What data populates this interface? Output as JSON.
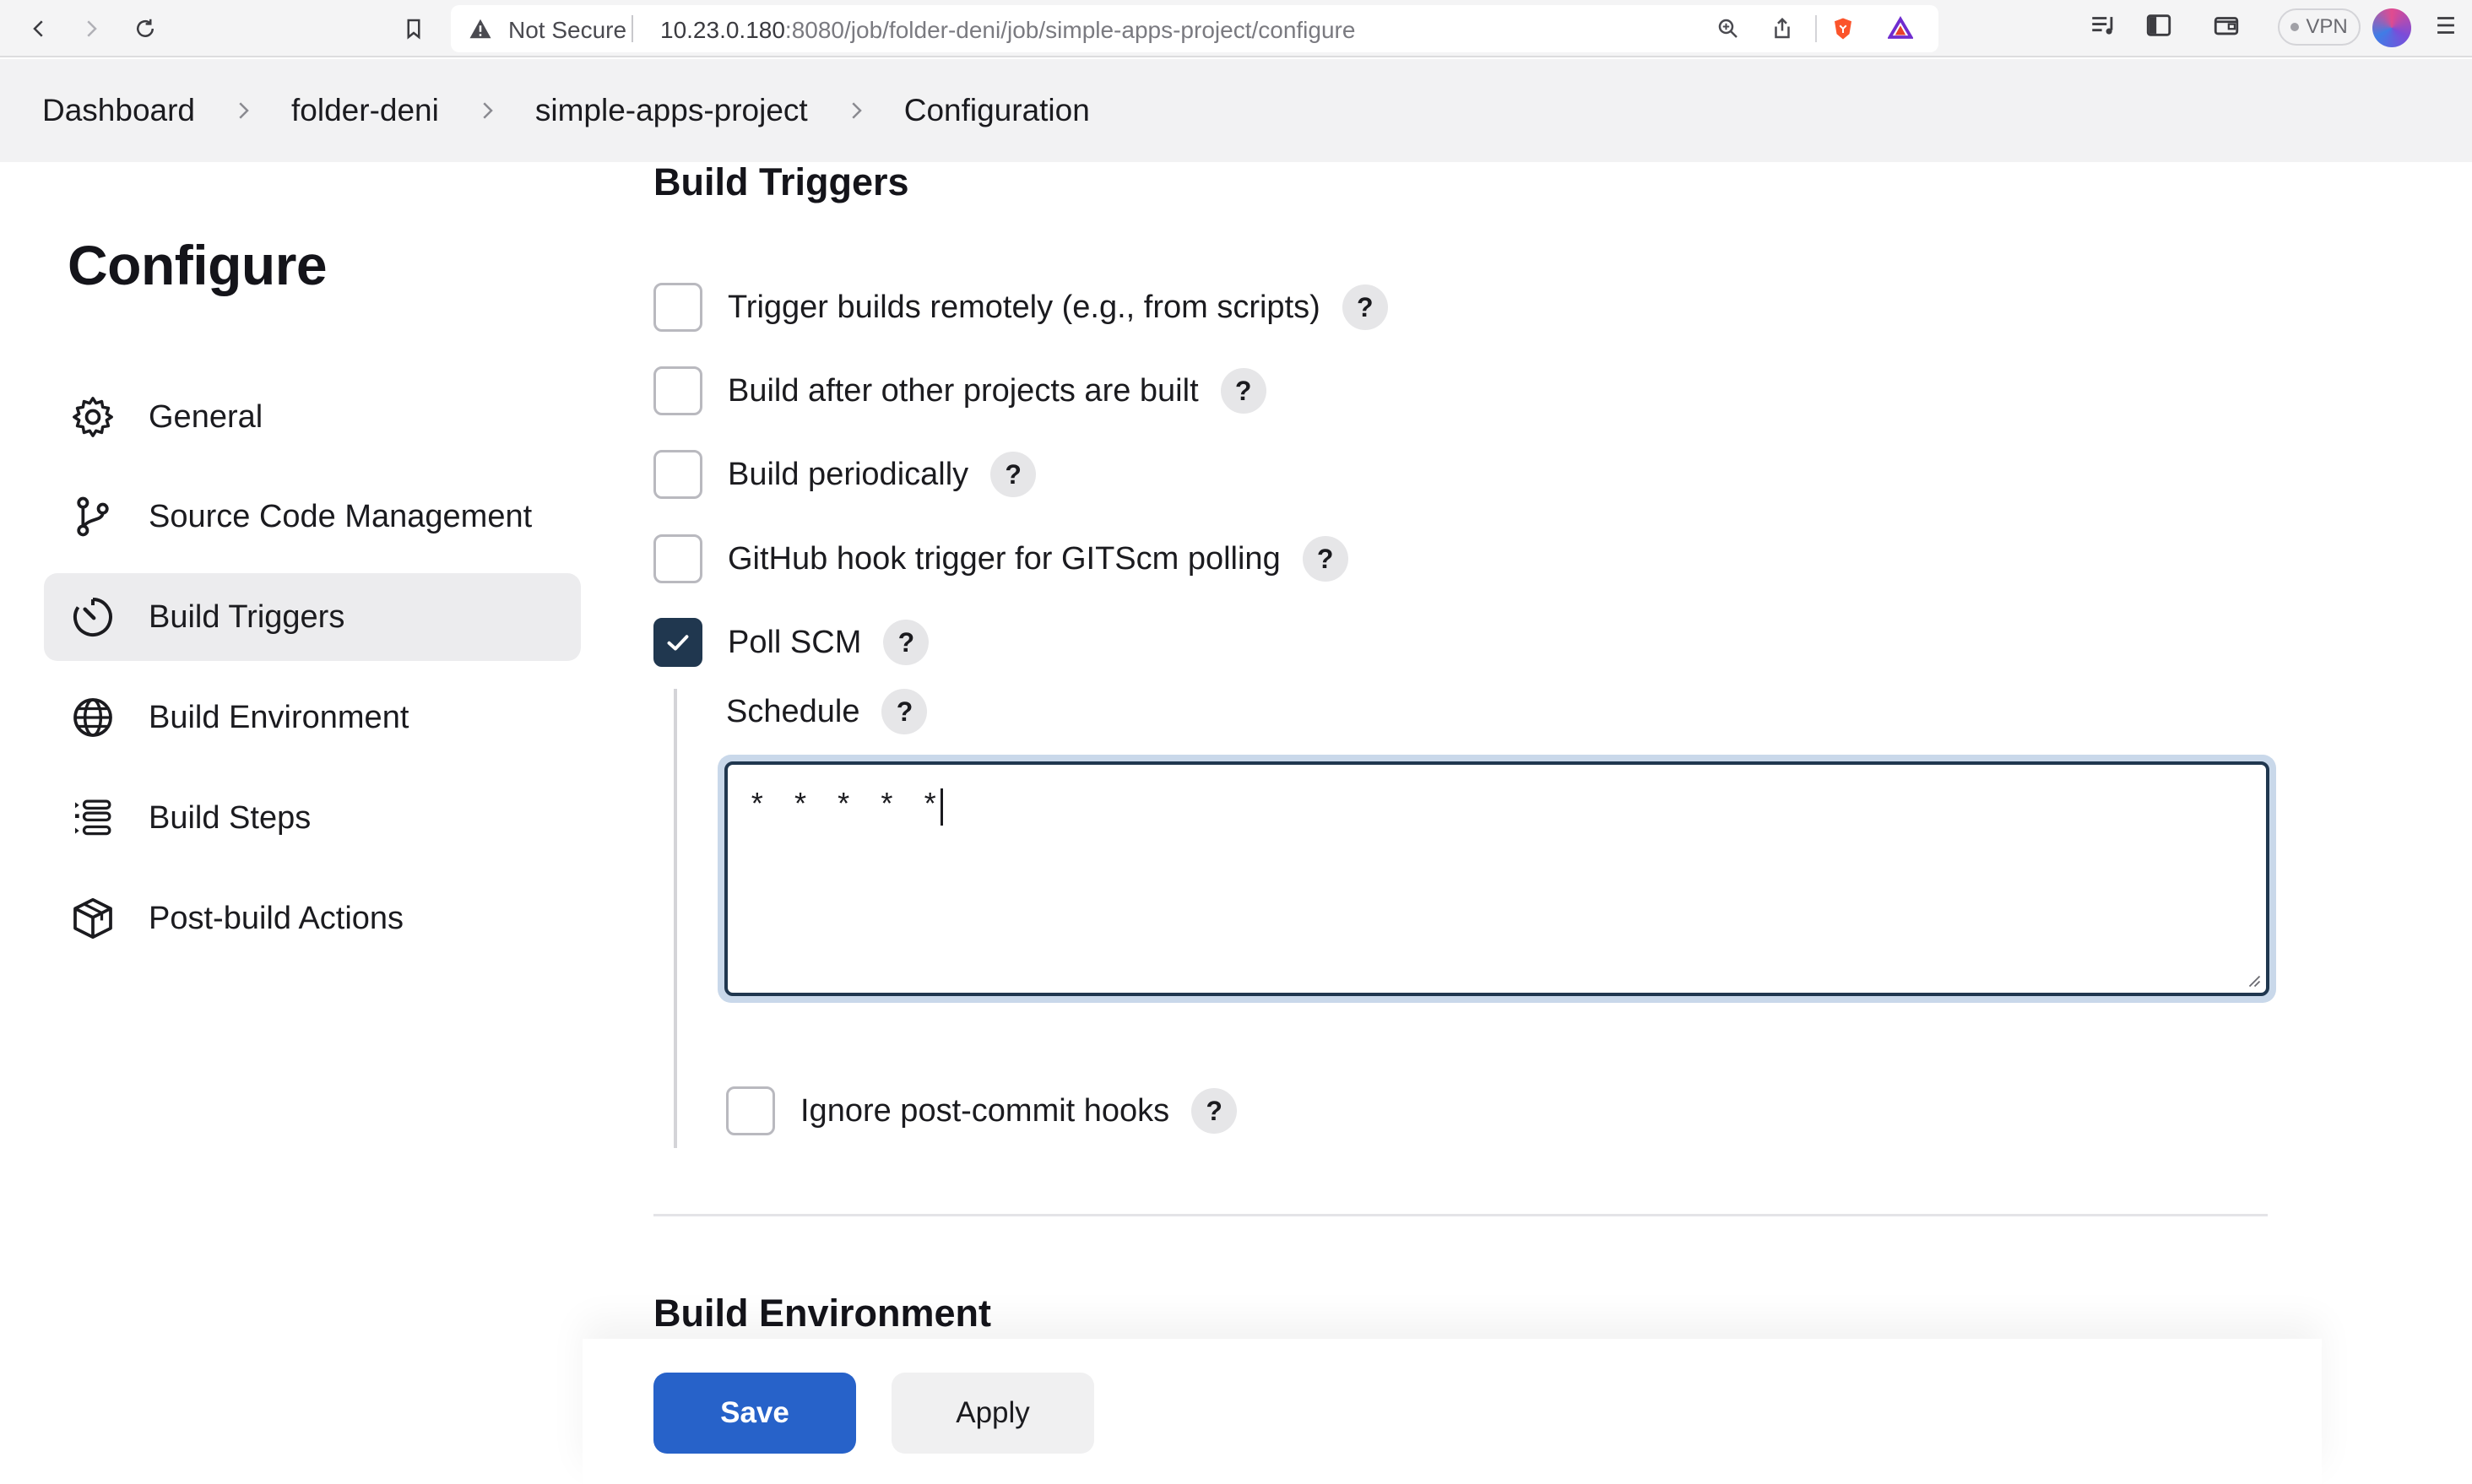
{
  "browser": {
    "security_label": "Not Secure",
    "url_host": "10.23.0.180",
    "url_port": ":8080",
    "url_path": "/job/folder-deni/job/simple-apps-project/configure",
    "vpn_label": "VPN"
  },
  "breadcrumb": [
    "Dashboard",
    "folder-deni",
    "simple-apps-project",
    "Configuration"
  ],
  "sidebar": {
    "title": "Configure",
    "items": [
      {
        "label": "General",
        "icon": "gear-icon"
      },
      {
        "label": "Source Code Management",
        "icon": "branch-icon"
      },
      {
        "label": "Build Triggers",
        "icon": "timer-icon",
        "active": true
      },
      {
        "label": "Build Environment",
        "icon": "globe-icon"
      },
      {
        "label": "Build Steps",
        "icon": "list-icon"
      },
      {
        "label": "Post-build Actions",
        "icon": "package-icon"
      }
    ]
  },
  "main": {
    "section_title": "Build Triggers",
    "options": [
      {
        "label": "Trigger builds remotely (e.g., from scripts)",
        "checked": false
      },
      {
        "label": "Build after other projects are built",
        "checked": false
      },
      {
        "label": "Build periodically",
        "checked": false
      },
      {
        "label": "GitHub hook trigger for GITScm polling",
        "checked": false
      },
      {
        "label": "Poll SCM",
        "checked": true
      }
    ],
    "schedule": {
      "label": "Schedule",
      "value": "* * * * *"
    },
    "ignore_hooks": {
      "label": "Ignore post-commit hooks",
      "checked": false
    },
    "help_label": "?",
    "next_section_title": "Build Environment"
  },
  "actions": {
    "save": "Save",
    "apply": "Apply"
  },
  "colors": {
    "primary": "#2762c9",
    "checked": "#20374f",
    "focus_ring": "#c9d8ea"
  }
}
